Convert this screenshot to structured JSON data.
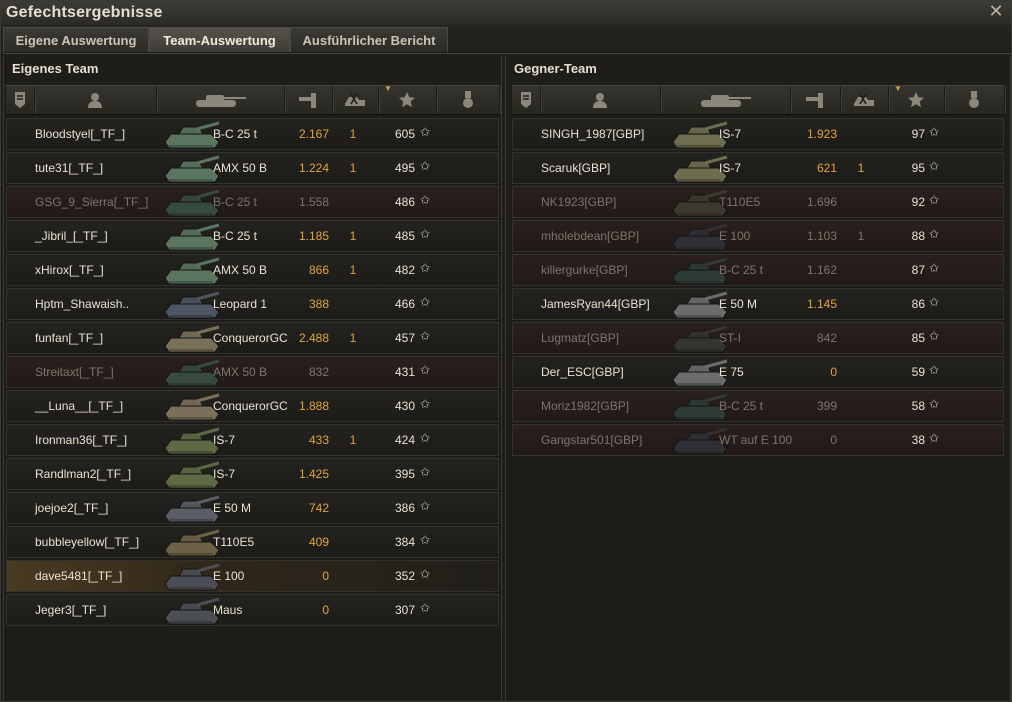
{
  "window": {
    "title": "Gefechtsergebnisse",
    "close_icon": "close-icon"
  },
  "tabs": [
    {
      "label": "Eigene Auswertung",
      "active": false
    },
    {
      "label": "Team-Auswertung",
      "active": true
    },
    {
      "label": "Ausführlicher Bericht",
      "active": false
    }
  ],
  "columns": [
    "squad-icon",
    "player-icon",
    "tank-icon",
    "damage-icon",
    "kills-icon",
    "xp-star-icon",
    "medal-icon"
  ],
  "colors": {
    "damage": "#e0a53f",
    "self_highlight": "#4a3a22",
    "destroyed_row": "#2a201e"
  },
  "own_team": {
    "title": "Eigenes Team",
    "rows": [
      {
        "player": "Bloodstyel[_TF_]",
        "vehicle": "B-C 25 t",
        "damage": "2.167",
        "kills": "1",
        "xp": "605",
        "state": "alive",
        "tank_color": "#5a7560"
      },
      {
        "player": "tute31[_TF_]",
        "vehicle": "AMX 50 B",
        "damage": "1.224",
        "kills": "1",
        "xp": "495",
        "state": "alive",
        "tank_color": "#5a7560"
      },
      {
        "player": "GSG_9_Sierra[_TF_]",
        "vehicle": "B-C 25 t",
        "damage": "1.558",
        "kills": "",
        "xp": "486",
        "state": "dead",
        "tank_color": "#364a40"
      },
      {
        "player": "_Jibril_[_TF_]",
        "vehicle": "B-C 25 t",
        "damage": "1.185",
        "kills": "1",
        "xp": "485",
        "state": "alive",
        "tank_color": "#5a7560"
      },
      {
        "player": "xHirox[_TF_]",
        "vehicle": "AMX 50 B",
        "damage": "866",
        "kills": "1",
        "xp": "482",
        "state": "alive",
        "tank_color": "#5a7560"
      },
      {
        "player": "Hptm_Shawaish..",
        "vehicle": "Leopard 1",
        "damage": "388",
        "kills": "",
        "xp": "466",
        "state": "alive",
        "tank_color": "#4e5663"
      },
      {
        "player": "funfan[_TF_]",
        "vehicle": "ConquerorGC",
        "damage": "2.488",
        "kills": "1",
        "xp": "457",
        "state": "alive",
        "tank_color": "#7a705a"
      },
      {
        "player": "Streitaxt[_TF_]",
        "vehicle": "AMX 50 B",
        "damage": "832",
        "kills": "",
        "xp": "431",
        "state": "dead",
        "tank_color": "#364a40"
      },
      {
        "player": "__Luna__[_TF_]",
        "vehicle": "ConquerorGC",
        "damage": "1.888",
        "kills": "",
        "xp": "430",
        "state": "alive",
        "tank_color": "#7a705a"
      },
      {
        "player": "Ironman36[_TF_]",
        "vehicle": "IS-7",
        "damage": "433",
        "kills": "1",
        "xp": "424",
        "state": "alive",
        "tank_color": "#5d6a44"
      },
      {
        "player": "Randlman2[_TF_]",
        "vehicle": "IS-7",
        "damage": "1.425",
        "kills": "",
        "xp": "395",
        "state": "alive",
        "tank_color": "#5d6a44"
      },
      {
        "player": "joejoe2[_TF_]",
        "vehicle": "E 50 M",
        "damage": "742",
        "kills": "",
        "xp": "386",
        "state": "alive",
        "tank_color": "#5a5d66"
      },
      {
        "player": "bubbleyellow[_TF_]",
        "vehicle": "T110E5",
        "damage": "409",
        "kills": "",
        "xp": "384",
        "state": "alive",
        "tank_color": "#6d6246"
      },
      {
        "player": "dave5481[_TF_]",
        "vehicle": "E 100",
        "damage": "0",
        "kills": "",
        "xp": "352",
        "state": "self",
        "tank_color": "#4b4e55"
      },
      {
        "player": "Jeger3[_TF_]",
        "vehicle": "Maus",
        "damage": "0",
        "kills": "",
        "xp": "307",
        "state": "alive",
        "tank_color": "#4b4e55"
      }
    ]
  },
  "enemy_team": {
    "title": "Gegner-Team",
    "rows": [
      {
        "player": "SINGH_1987[GBP]",
        "vehicle": "IS-7",
        "damage": "1.923",
        "kills": "",
        "xp": "97",
        "state": "alive",
        "tank_color": "#6d6e50"
      },
      {
        "player": "Scaruk[GBP]",
        "vehicle": "IS-7",
        "damage": "621",
        "kills": "1",
        "xp": "95",
        "state": "alive",
        "tank_color": "#6d6e50"
      },
      {
        "player": "NK1923[GBP]",
        "vehicle": "T110E5",
        "damage": "1.696",
        "kills": "",
        "xp": "92",
        "state": "dead",
        "tank_color": "#3c3a2e"
      },
      {
        "player": "mholebdean[GBP]",
        "vehicle": "E 100",
        "damage": "1.103",
        "kills": "1",
        "xp": "88",
        "state": "dead",
        "tank_color": "#2e3035"
      },
      {
        "player": "killergurke[GBP]",
        "vehicle": "B-C 25 t",
        "damage": "1.162",
        "kills": "",
        "xp": "87",
        "state": "dead",
        "tank_color": "#2e3a36"
      },
      {
        "player": "JamesRyan44[GBP]",
        "vehicle": "E 50 M",
        "damage": "1.145",
        "kills": "",
        "xp": "86",
        "state": "alive",
        "tank_color": "#6a6c6e"
      },
      {
        "player": "Lugmatz[GBP]",
        "vehicle": "ST-I",
        "damage": "842",
        "kills": "",
        "xp": "85",
        "state": "dead",
        "tank_color": "#33352e"
      },
      {
        "player": "Der_ESC[GBP]",
        "vehicle": "E 75",
        "damage": "0",
        "kills": "",
        "xp": "59",
        "state": "alive",
        "tank_color": "#6a6c6e"
      },
      {
        "player": "Moriz1982[GBP]",
        "vehicle": "B-C 25 t",
        "damage": "399",
        "kills": "",
        "xp": "58",
        "state": "dead",
        "tank_color": "#2e3a36"
      },
      {
        "player": "Gangstar501[GBP]",
        "vehicle": "WT auf E 100",
        "damage": "0",
        "kills": "",
        "xp": "38",
        "state": "dead",
        "tank_color": "#2e3035"
      }
    ]
  }
}
